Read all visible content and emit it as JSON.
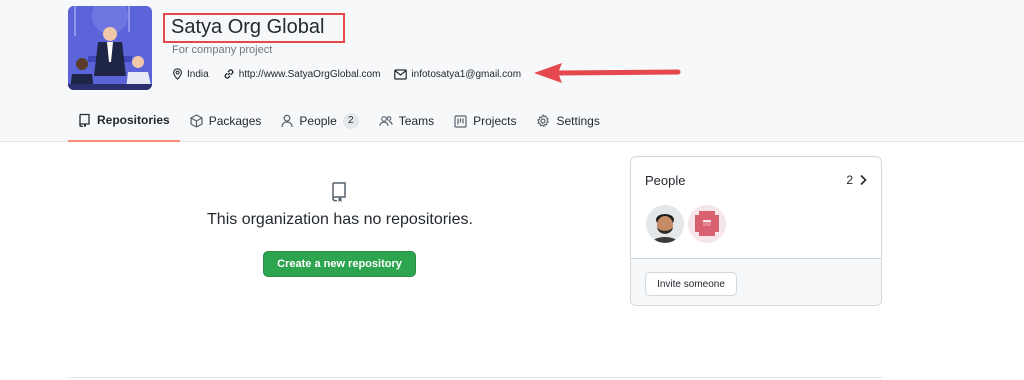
{
  "org": {
    "name": "Satya Org Global",
    "description": "For company project",
    "location": "India",
    "website": "http://www.SatyaOrgGlobal.com",
    "email": "infotosatya1@gmail.com"
  },
  "tabs": [
    {
      "label": "Repositories",
      "icon": "repo-icon",
      "active": true
    },
    {
      "label": "Packages",
      "icon": "package-icon"
    },
    {
      "label": "People",
      "icon": "person-icon",
      "count": "2"
    },
    {
      "label": "Teams",
      "icon": "people-icon"
    },
    {
      "label": "Projects",
      "icon": "project-icon"
    },
    {
      "label": "Settings",
      "icon": "gear-icon"
    }
  ],
  "empty_state": {
    "message": "This organization has no repositories.",
    "button_label": "Create a new repository"
  },
  "people_card": {
    "title": "People",
    "count": "2",
    "invite_label": "Invite someone"
  },
  "colors": {
    "accent_green": "#2da44e",
    "tab_underline": "#fd8c73",
    "annotation_red": "#e5484d"
  }
}
